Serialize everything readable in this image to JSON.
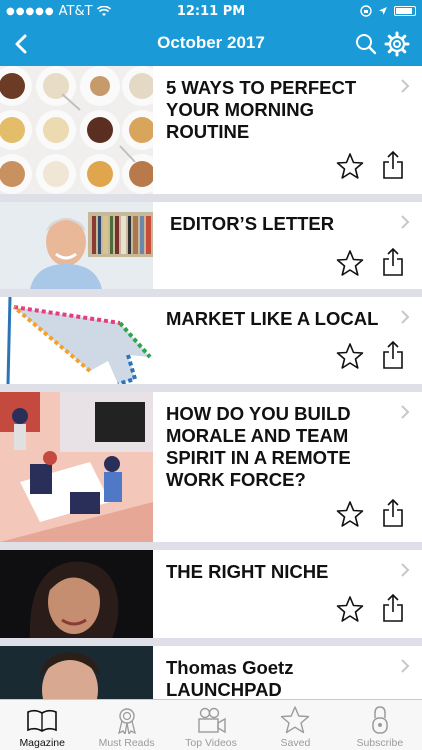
{
  "status_bar": {
    "carrier": "AT&T",
    "time": "12:11 PM"
  },
  "header": {
    "title": "October 2017"
  },
  "articles": [
    {
      "title": "5 WAYS TO PERFECT\nYOUR MORNING\nROUTINE"
    },
    {
      "title": "EDITOR’S LETTER"
    },
    {
      "title": "MARKET LIKE A LOCAL"
    },
    {
      "title": "HOW DO YOU BUILD\nMORALE AND TEAM\nSPIRIT IN A REMOTE\nWORK FORCE?"
    },
    {
      "title": "THE RIGHT NICHE"
    },
    {
      "title": "Thomas Goetz\nLAUNCHPAD"
    }
  ],
  "tabs": [
    {
      "label": "Magazine",
      "icon": "book-icon",
      "active": true
    },
    {
      "label": "Must Reads",
      "icon": "ribbon-icon",
      "active": false
    },
    {
      "label": "Top Videos",
      "icon": "video-camera-icon",
      "active": false
    },
    {
      "label": "Saved",
      "icon": "star-icon",
      "active": false
    },
    {
      "label": "Subscribe",
      "icon": "lock-icon",
      "active": false
    }
  ],
  "colors": {
    "brand_blue": "#1a9ad6",
    "separator": "#dfe0e7",
    "tab_inactive": "#9b9b9b"
  }
}
